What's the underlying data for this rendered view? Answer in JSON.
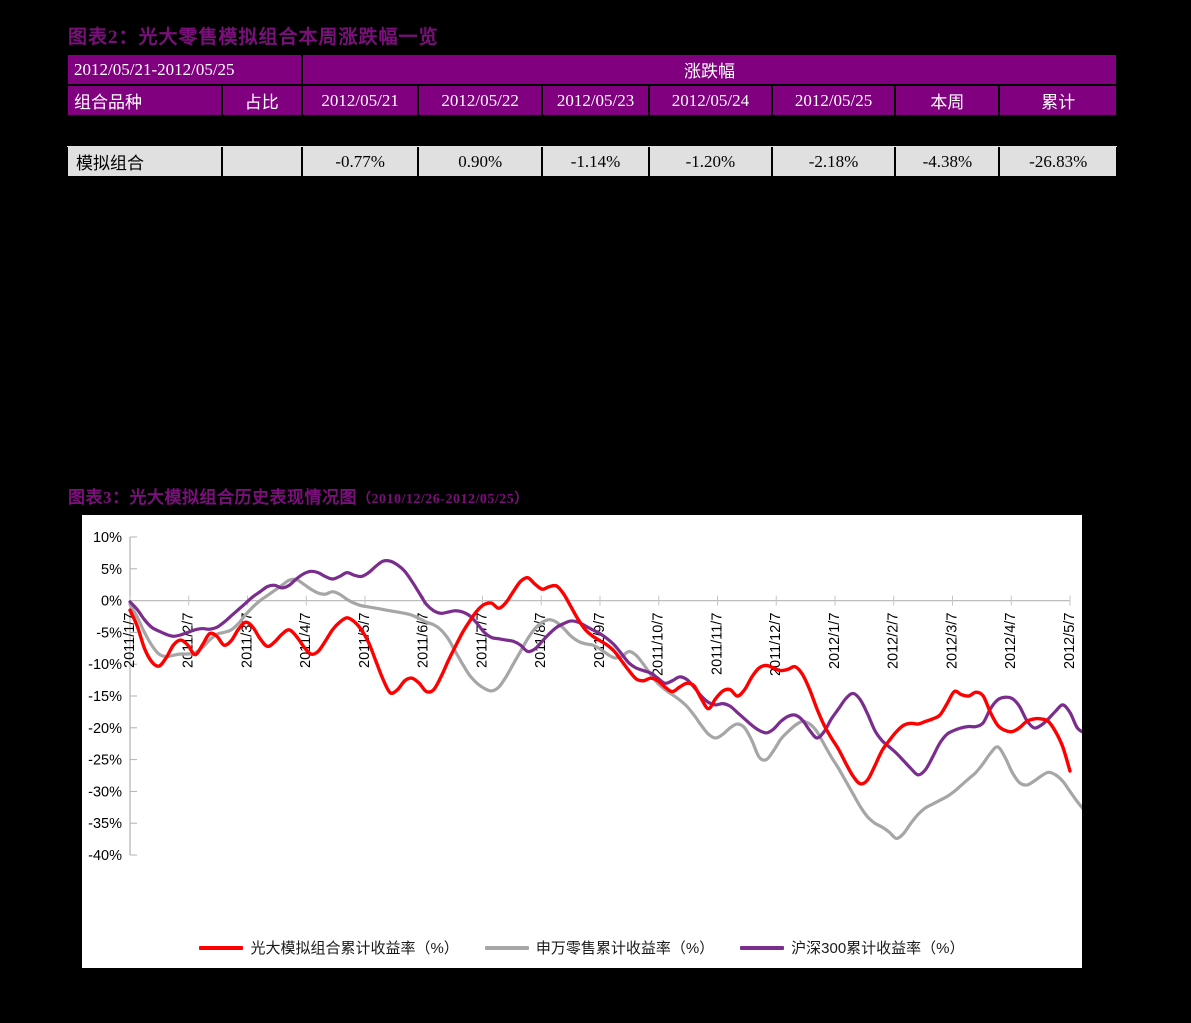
{
  "exhibit2": {
    "title": "图表2：光大零售模拟组合本周涨跌幅一览",
    "period_header": "2012/05/21-2012/05/25",
    "group_header": "涨跌幅",
    "columns": [
      "组合品种",
      "占比",
      "2012/05/21",
      "2012/05/22",
      "2012/05/23",
      "2012/05/24",
      "2012/05/25",
      "本周",
      "累计"
    ],
    "rows": [
      {
        "name": "模拟组合",
        "share": "",
        "d1": "-0.77%",
        "d2": "0.90%",
        "d3": "-1.14%",
        "d4": "-1.20%",
        "d5": "-2.18%",
        "week": "-4.38%",
        "cumulative": "-26.83%"
      }
    ]
  },
  "exhibit3": {
    "title": "图表3：光大模拟组合历史表现情况图",
    "title_range": "（2010/12/26-2012/05/25）"
  },
  "colors": {
    "brand_purple": "#800080",
    "title_purple": "#7b0f7b",
    "series_red": "#ff0000",
    "series_gray": "#a6a6a6",
    "series_purple": "#7b2d8e",
    "table_cell_bg": "#e0e0e0",
    "panel_bg": "#ffffff"
  },
  "chart_data": {
    "type": "line",
    "title": "光大模拟组合历史表现情况图（2010/12/26-2012/05/25）",
    "xlabel": "",
    "ylabel": "",
    "ylim": [
      -40,
      10
    ],
    "ytick_labels": [
      "10%",
      "5%",
      "0%",
      "-5%",
      "-10%",
      "-15%",
      "-20%",
      "-25%",
      "-30%",
      "-35%",
      "-40%"
    ],
    "ytick_values": [
      10,
      5,
      0,
      -5,
      -10,
      -15,
      -20,
      -25,
      -30,
      -35,
      -40
    ],
    "xtick_labels": [
      "2011/1/7",
      "2011/2/7",
      "2011/3/7",
      "2011/4/7",
      "2011/5/7",
      "2011/6/7",
      "2011/7/7",
      "2011/8/7",
      "2011/9/7",
      "2011/10/7",
      "2011/11/7",
      "2011/12/7",
      "2012/1/7",
      "2012/2/7",
      "2012/3/7",
      "2012/4/7",
      "2012/5/7"
    ],
    "grid": false,
    "legend_position": "bottom",
    "series": [
      {
        "name": "光大模拟组合累计收益率（%）",
        "color": "#ff0000",
        "values": [
          -1.5,
          -4.0,
          -7.5,
          -9.6,
          -10.3,
          -9.0,
          -7.0,
          -6.2,
          -7.0,
          -8.5,
          -7.0,
          -5.2,
          -5.6,
          -7.0,
          -6.3,
          -4.5,
          -3.4,
          -4.2,
          -6.0,
          -7.2,
          -6.5,
          -5.3,
          -4.6,
          -5.6,
          -7.2,
          -8.4,
          -8.0,
          -6.4,
          -4.6,
          -3.4,
          -2.7,
          -3.3,
          -4.6,
          -6.6,
          -9.5,
          -12.4,
          -14.5,
          -14.0,
          -12.6,
          -12.2,
          -13.0,
          -14.3,
          -14.0,
          -12.0,
          -9.5,
          -7.2,
          -5.0,
          -3.2,
          -1.6,
          -0.6,
          -0.4,
          -1.2,
          -0.3,
          1.4,
          3.0,
          3.6,
          2.6,
          1.8,
          2.2,
          2.3,
          1.0,
          -1.0,
          -3.0,
          -4.6,
          -5.6,
          -6.3,
          -7.0,
          -8.0,
          -9.5,
          -11.0,
          -12.3,
          -12.6,
          -12.2,
          -12.6,
          -13.6,
          -14.3,
          -13.6,
          -13.0,
          -13.4,
          -15.4,
          -17.0,
          -15.4,
          -14.2,
          -14.0,
          -15.0,
          -14.0,
          -12.0,
          -10.6,
          -10.2,
          -10.6,
          -11.0,
          -10.8,
          -10.4,
          -11.6,
          -14.0,
          -17.0,
          -19.6,
          -21.6,
          -23.4,
          -25.6,
          -27.6,
          -28.8,
          -28.2,
          -26.0,
          -23.6,
          -22.0,
          -20.6,
          -19.6,
          -19.3,
          -19.4,
          -19.0,
          -18.6,
          -18.0,
          -16.2,
          -14.3,
          -14.8,
          -15.0,
          -14.4,
          -15.0,
          -17.6,
          -19.6,
          -20.4,
          -20.6,
          -20.0,
          -19.0,
          -18.6,
          -18.6,
          -19.0,
          -20.6,
          -23.0,
          -26.8
        ]
      },
      {
        "name": "申万零售累计收益率（%）",
        "color": "#a6a6a6",
        "values": [
          -0.6,
          -2.6,
          -5.0,
          -7.0,
          -8.4,
          -8.8,
          -8.6,
          -8.4,
          -8.4,
          -8.2,
          -7.4,
          -6.2,
          -5.3,
          -5.0,
          -4.6,
          -3.6,
          -2.2,
          -1.0,
          0.0,
          0.8,
          1.6,
          2.4,
          3.2,
          3.3,
          2.6,
          1.8,
          1.2,
          1.0,
          1.4,
          1.0,
          0.2,
          -0.4,
          -0.8,
          -1.0,
          -1.2,
          -1.4,
          -1.6,
          -1.8,
          -2.0,
          -2.3,
          -2.8,
          -3.4,
          -3.8,
          -4.6,
          -6.0,
          -8.0,
          -10.0,
          -11.8,
          -13.0,
          -13.8,
          -14.2,
          -13.6,
          -12.0,
          -10.0,
          -8.0,
          -6.0,
          -4.4,
          -3.4,
          -3.0,
          -3.4,
          -4.4,
          -5.6,
          -6.4,
          -6.8,
          -7.0,
          -7.6,
          -8.4,
          -9.0,
          -8.8,
          -8.0,
          -8.6,
          -10.0,
          -11.6,
          -13.0,
          -14.0,
          -14.8,
          -15.6,
          -16.6,
          -18.0,
          -19.6,
          -21.0,
          -21.6,
          -21.0,
          -20.0,
          -19.4,
          -20.0,
          -22.0,
          -24.6,
          -25.0,
          -23.6,
          -21.8,
          -20.6,
          -19.6,
          -19.0,
          -19.4,
          -20.6,
          -22.6,
          -24.6,
          -26.4,
          -28.4,
          -30.4,
          -32.4,
          -34.0,
          -35.0,
          -35.6,
          -36.4,
          -37.4,
          -36.6,
          -35.0,
          -33.6,
          -32.6,
          -32.0,
          -31.4,
          -30.8,
          -30.0,
          -29.0,
          -28.0,
          -27.0,
          -25.6,
          -24.0,
          -23.0,
          -24.6,
          -27.0,
          -28.6,
          -29.0,
          -28.4,
          -27.6,
          -27.0,
          -27.4,
          -28.4,
          -30.0,
          -31.6,
          -33.0
        ]
      },
      {
        "name": "沪深300累计收益率（%）",
        "color": "#7b2d8e",
        "values": [
          -0.2,
          -1.4,
          -3.0,
          -4.2,
          -4.8,
          -5.3,
          -5.6,
          -5.4,
          -5.0,
          -4.6,
          -4.4,
          -4.5,
          -4.2,
          -3.4,
          -2.4,
          -1.4,
          -0.4,
          0.6,
          1.4,
          2.2,
          2.4,
          2.0,
          2.4,
          3.4,
          4.2,
          4.6,
          4.4,
          3.8,
          3.4,
          3.8,
          4.4,
          4.0,
          3.8,
          4.4,
          5.4,
          6.2,
          6.2,
          5.6,
          4.6,
          3.0,
          1.2,
          -0.6,
          -1.6,
          -2.0,
          -1.8,
          -1.6,
          -1.8,
          -2.4,
          -3.6,
          -5.0,
          -5.8,
          -6.0,
          -6.2,
          -6.4,
          -7.0,
          -8.0,
          -7.6,
          -6.4,
          -5.2,
          -4.2,
          -3.6,
          -3.2,
          -3.4,
          -4.0,
          -4.6,
          -5.2,
          -6.0,
          -7.0,
          -8.4,
          -9.8,
          -10.6,
          -11.0,
          -11.4,
          -12.2,
          -13.0,
          -12.6,
          -12.0,
          -12.4,
          -13.6,
          -15.0,
          -16.0,
          -16.4,
          -16.2,
          -16.6,
          -17.6,
          -18.6,
          -19.6,
          -20.4,
          -20.8,
          -20.2,
          -19.0,
          -18.2,
          -18.0,
          -18.8,
          -20.4,
          -21.6,
          -20.6,
          -18.6,
          -17.0,
          -15.4,
          -14.6,
          -15.6,
          -17.8,
          -20.4,
          -22.0,
          -23.0,
          -24.0,
          -25.2,
          -26.4,
          -27.4,
          -26.6,
          -24.6,
          -22.4,
          -21.0,
          -20.4,
          -20.0,
          -19.8,
          -19.8,
          -19.2,
          -17.0,
          -15.6,
          -15.2,
          -15.4,
          -16.6,
          -18.8,
          -20.0,
          -19.6,
          -18.6,
          -17.4,
          -16.4,
          -17.6,
          -20.0,
          -20.8
        ]
      }
    ]
  }
}
